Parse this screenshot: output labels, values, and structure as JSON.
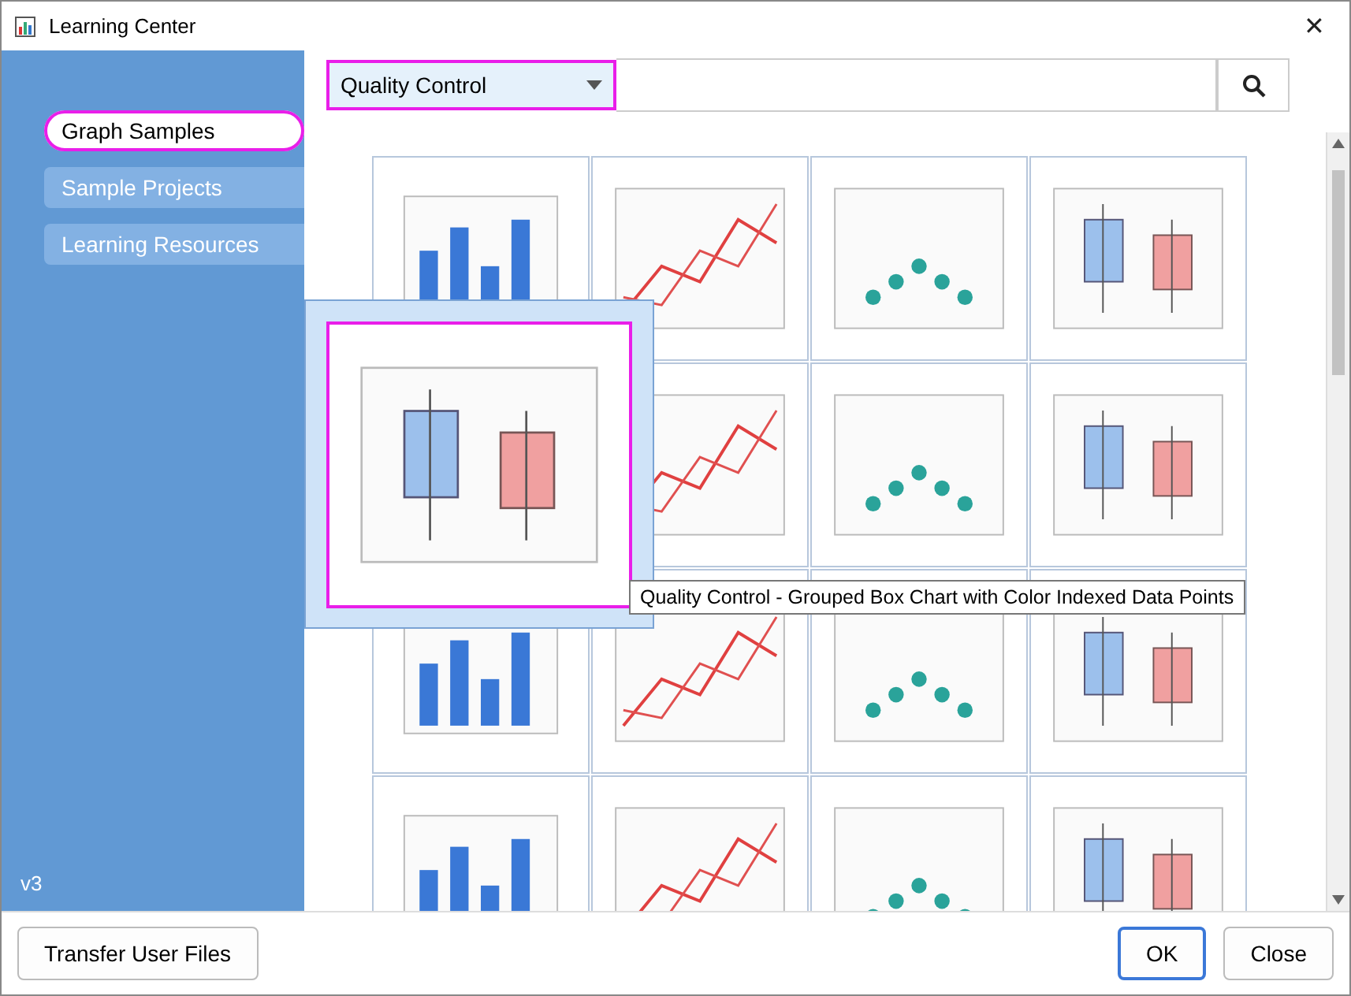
{
  "window": {
    "title": "Learning Center",
    "close": "✕"
  },
  "sidebar": {
    "items": [
      {
        "label": "Graph Samples",
        "selected": true,
        "highlighted": true
      },
      {
        "label": "Sample Projects",
        "selected": false,
        "highlighted": false
      },
      {
        "label": "Learning Resources",
        "selected": false,
        "highlighted": false
      }
    ],
    "version": "v3"
  },
  "category_dropdown": {
    "value": "Quality Control",
    "highlighted": true
  },
  "thumbnails": [
    {
      "kind": "picture",
      "hovered": false
    },
    {
      "kind": "picture",
      "hovered": false
    },
    {
      "kind": "picture",
      "hovered": false
    },
    {
      "kind": "picture",
      "hovered": false
    },
    {
      "kind": "picture",
      "hovered": true,
      "highlighted": true,
      "tooltip": "Quality Control - Grouped Box Chart with Color Indexed Data Points"
    },
    {
      "kind": "picture",
      "hovered": false
    },
    {
      "kind": "picture",
      "hovered": false
    },
    {
      "kind": "picture",
      "hovered": false
    },
    {
      "kind": "picture",
      "hovered": false
    },
    {
      "kind": "picture",
      "hovered": false
    },
    {
      "kind": "picture",
      "hovered": false
    },
    {
      "kind": "picture",
      "hovered": false
    },
    {
      "kind": "picture",
      "hovered": false
    },
    {
      "kind": "picture",
      "hovered": false
    },
    {
      "kind": "picture",
      "hovered": false
    },
    {
      "kind": "picture",
      "hovered": false
    }
  ],
  "buttons": [
    {
      "label": "Transfer User Files",
      "kind": "left"
    },
    {
      "label": "OK",
      "kind": "default"
    },
    {
      "label": "Close",
      "kind": "normal"
    }
  ]
}
